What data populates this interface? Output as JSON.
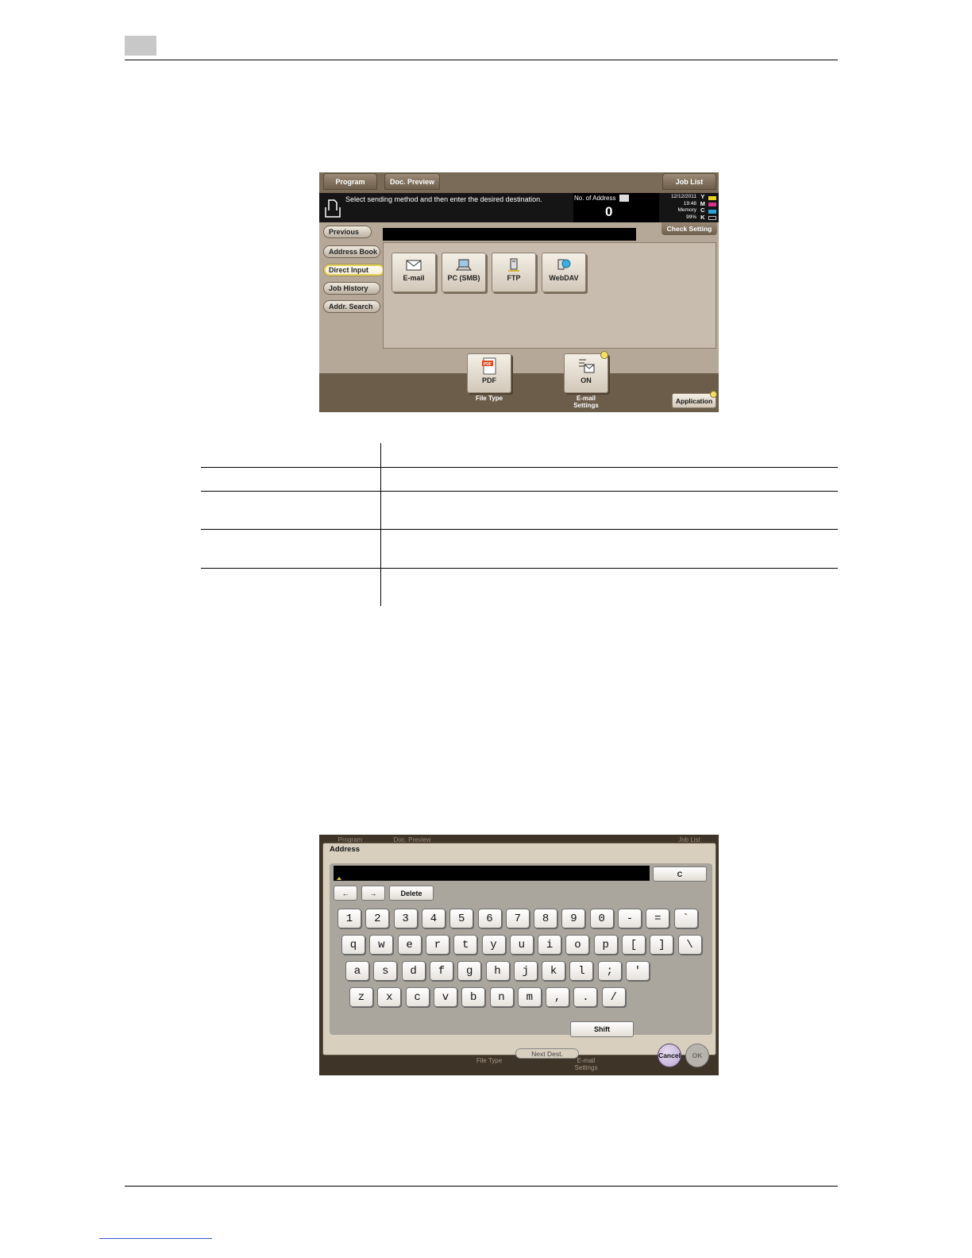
{
  "screen1": {
    "tabs": {
      "program": "Program",
      "preview": "Doc. Preview",
      "joblist": "Job List"
    },
    "message": "Select sending method and then enter the desired destination.",
    "address": {
      "label": "No. of Address",
      "count": "0"
    },
    "status": {
      "date": "12/12/2011",
      "time": "19:48",
      "memory_label": "Memory",
      "memory_value": "99%",
      "toner": [
        "Y",
        "M",
        "C",
        "K"
      ],
      "toner_colors": [
        "#e8d21e",
        "#d8338a",
        "#2aa2dc",
        "#111111"
      ]
    },
    "check_setting": "Check Setting",
    "sidebar": {
      "previous": "Previous",
      "address_book": "Address Book",
      "direct_input": "Direct Input",
      "job_history": "Job History",
      "addr_search": "Addr. Search"
    },
    "destinations": [
      "E-mail",
      "PC (SMB)",
      "FTP",
      "WebDAV"
    ],
    "file_type": {
      "value": "PDF",
      "caption": "File Type"
    },
    "email_settings": {
      "value": "ON",
      "caption_1": "E-mail",
      "caption_2": "Settings"
    },
    "application": "Application"
  },
  "screen2": {
    "bg": {
      "program": "Program",
      "preview": "Doc. Preview",
      "joblist": "Job List",
      "file_type": "File Type",
      "email_1": "E-mail",
      "email_2": "Settings"
    },
    "title": "Address",
    "c_button": "C",
    "left_arrow": "←",
    "right_arrow": "→",
    "delete": "Delete",
    "rows": [
      [
        "1",
        "2",
        "3",
        "4",
        "5",
        "6",
        "7",
        "8",
        "9",
        "0",
        "-",
        "=",
        "`"
      ],
      [
        "q",
        "w",
        "e",
        "r",
        "t",
        "y",
        "u",
        "i",
        "o",
        "p",
        "[",
        "]",
        "\\"
      ],
      [
        "a",
        "s",
        "d",
        "f",
        "g",
        "h",
        "j",
        "k",
        "l",
        ";",
        "'"
      ],
      [
        "z",
        "x",
        "c",
        "v",
        "b",
        "n",
        "m",
        ",",
        ".",
        "/"
      ]
    ],
    "shift": "Shift",
    "next_dest": "Next Dest.",
    "cancel": "Cancel",
    "ok": "OK"
  }
}
